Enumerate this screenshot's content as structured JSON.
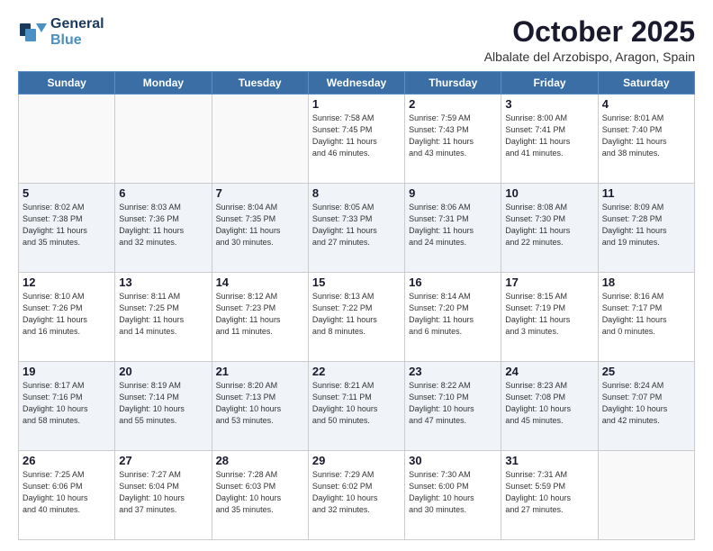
{
  "header": {
    "logo_line1": "General",
    "logo_line2": "Blue",
    "month_title": "October 2025",
    "location": "Albalate del Arzobispo, Aragon, Spain"
  },
  "weekdays": [
    "Sunday",
    "Monday",
    "Tuesday",
    "Wednesday",
    "Thursday",
    "Friday",
    "Saturday"
  ],
  "weeks": [
    [
      {
        "day": "",
        "info": ""
      },
      {
        "day": "",
        "info": ""
      },
      {
        "day": "",
        "info": ""
      },
      {
        "day": "1",
        "info": "Sunrise: 7:58 AM\nSunset: 7:45 PM\nDaylight: 11 hours\nand 46 minutes."
      },
      {
        "day": "2",
        "info": "Sunrise: 7:59 AM\nSunset: 7:43 PM\nDaylight: 11 hours\nand 43 minutes."
      },
      {
        "day": "3",
        "info": "Sunrise: 8:00 AM\nSunset: 7:41 PM\nDaylight: 11 hours\nand 41 minutes."
      },
      {
        "day": "4",
        "info": "Sunrise: 8:01 AM\nSunset: 7:40 PM\nDaylight: 11 hours\nand 38 minutes."
      }
    ],
    [
      {
        "day": "5",
        "info": "Sunrise: 8:02 AM\nSunset: 7:38 PM\nDaylight: 11 hours\nand 35 minutes."
      },
      {
        "day": "6",
        "info": "Sunrise: 8:03 AM\nSunset: 7:36 PM\nDaylight: 11 hours\nand 32 minutes."
      },
      {
        "day": "7",
        "info": "Sunrise: 8:04 AM\nSunset: 7:35 PM\nDaylight: 11 hours\nand 30 minutes."
      },
      {
        "day": "8",
        "info": "Sunrise: 8:05 AM\nSunset: 7:33 PM\nDaylight: 11 hours\nand 27 minutes."
      },
      {
        "day": "9",
        "info": "Sunrise: 8:06 AM\nSunset: 7:31 PM\nDaylight: 11 hours\nand 24 minutes."
      },
      {
        "day": "10",
        "info": "Sunrise: 8:08 AM\nSunset: 7:30 PM\nDaylight: 11 hours\nand 22 minutes."
      },
      {
        "day": "11",
        "info": "Sunrise: 8:09 AM\nSunset: 7:28 PM\nDaylight: 11 hours\nand 19 minutes."
      }
    ],
    [
      {
        "day": "12",
        "info": "Sunrise: 8:10 AM\nSunset: 7:26 PM\nDaylight: 11 hours\nand 16 minutes."
      },
      {
        "day": "13",
        "info": "Sunrise: 8:11 AM\nSunset: 7:25 PM\nDaylight: 11 hours\nand 14 minutes."
      },
      {
        "day": "14",
        "info": "Sunrise: 8:12 AM\nSunset: 7:23 PM\nDaylight: 11 hours\nand 11 minutes."
      },
      {
        "day": "15",
        "info": "Sunrise: 8:13 AM\nSunset: 7:22 PM\nDaylight: 11 hours\nand 8 minutes."
      },
      {
        "day": "16",
        "info": "Sunrise: 8:14 AM\nSunset: 7:20 PM\nDaylight: 11 hours\nand 6 minutes."
      },
      {
        "day": "17",
        "info": "Sunrise: 8:15 AM\nSunset: 7:19 PM\nDaylight: 11 hours\nand 3 minutes."
      },
      {
        "day": "18",
        "info": "Sunrise: 8:16 AM\nSunset: 7:17 PM\nDaylight: 11 hours\nand 0 minutes."
      }
    ],
    [
      {
        "day": "19",
        "info": "Sunrise: 8:17 AM\nSunset: 7:16 PM\nDaylight: 10 hours\nand 58 minutes."
      },
      {
        "day": "20",
        "info": "Sunrise: 8:19 AM\nSunset: 7:14 PM\nDaylight: 10 hours\nand 55 minutes."
      },
      {
        "day": "21",
        "info": "Sunrise: 8:20 AM\nSunset: 7:13 PM\nDaylight: 10 hours\nand 53 minutes."
      },
      {
        "day": "22",
        "info": "Sunrise: 8:21 AM\nSunset: 7:11 PM\nDaylight: 10 hours\nand 50 minutes."
      },
      {
        "day": "23",
        "info": "Sunrise: 8:22 AM\nSunset: 7:10 PM\nDaylight: 10 hours\nand 47 minutes."
      },
      {
        "day": "24",
        "info": "Sunrise: 8:23 AM\nSunset: 7:08 PM\nDaylight: 10 hours\nand 45 minutes."
      },
      {
        "day": "25",
        "info": "Sunrise: 8:24 AM\nSunset: 7:07 PM\nDaylight: 10 hours\nand 42 minutes."
      }
    ],
    [
      {
        "day": "26",
        "info": "Sunrise: 7:25 AM\nSunset: 6:06 PM\nDaylight: 10 hours\nand 40 minutes."
      },
      {
        "day": "27",
        "info": "Sunrise: 7:27 AM\nSunset: 6:04 PM\nDaylight: 10 hours\nand 37 minutes."
      },
      {
        "day": "28",
        "info": "Sunrise: 7:28 AM\nSunset: 6:03 PM\nDaylight: 10 hours\nand 35 minutes."
      },
      {
        "day": "29",
        "info": "Sunrise: 7:29 AM\nSunset: 6:02 PM\nDaylight: 10 hours\nand 32 minutes."
      },
      {
        "day": "30",
        "info": "Sunrise: 7:30 AM\nSunset: 6:00 PM\nDaylight: 10 hours\nand 30 minutes."
      },
      {
        "day": "31",
        "info": "Sunrise: 7:31 AM\nSunset: 5:59 PM\nDaylight: 10 hours\nand 27 minutes."
      },
      {
        "day": "",
        "info": ""
      }
    ]
  ]
}
